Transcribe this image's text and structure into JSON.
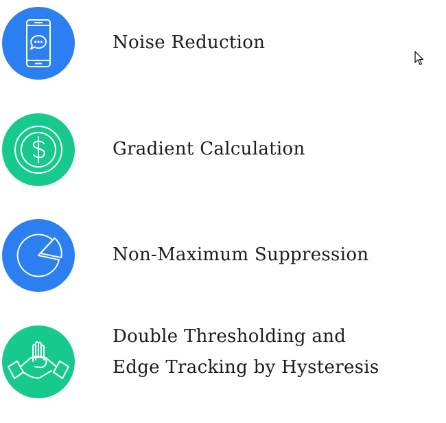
{
  "colors": {
    "blue": "#2b7ff0",
    "green": "#17c98c",
    "text": "#1c1c1c"
  },
  "steps": [
    {
      "icon": "smartphone-chat-icon",
      "color": "blue",
      "label": "Noise Reduction"
    },
    {
      "icon": "dollar-coin-icon",
      "color": "green",
      "label": "Gradient Calculation"
    },
    {
      "icon": "pie-chart-icon",
      "color": "blue",
      "label": "Non-Maximum Suppression"
    },
    {
      "icon": "handshake-hands-icon",
      "color": "green",
      "label_lines": [
        "Double Thresholding and",
        "Edge Tracking by Hysteresis"
      ]
    }
  ]
}
